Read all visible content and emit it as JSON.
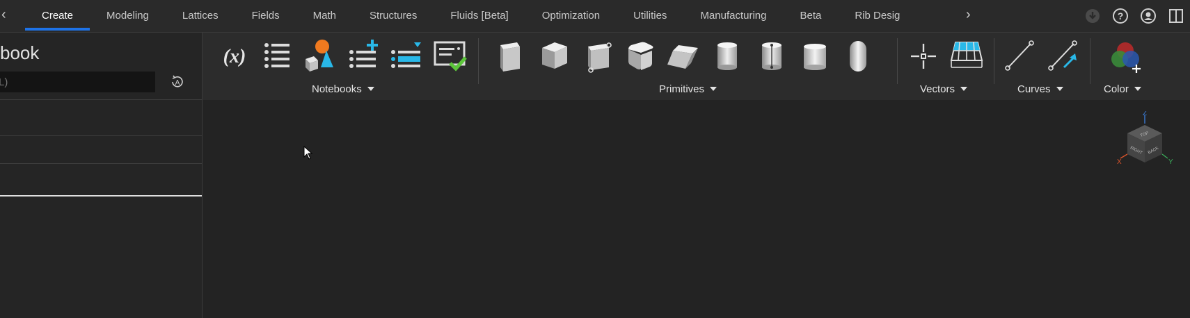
{
  "tabs": [
    {
      "label": "Create",
      "active": true
    },
    {
      "label": "Modeling"
    },
    {
      "label": "Lattices"
    },
    {
      "label": "Fields"
    },
    {
      "label": "Math"
    },
    {
      "label": "Structures"
    },
    {
      "label": "Fluids [Beta]"
    },
    {
      "label": "Optimization"
    },
    {
      "label": "Utilities"
    },
    {
      "label": "Manufacturing"
    },
    {
      "label": "Beta"
    },
    {
      "label": "Rib Desig"
    }
  ],
  "top_icons": [
    "download-icon",
    "help-icon",
    "account-icon",
    "panel-toggle-icon"
  ],
  "left_panel": {
    "title": "book",
    "input_value": "L)",
    "refresh_icon_letter": "A"
  },
  "ribbon": {
    "groups": [
      {
        "label": "Notebooks"
      },
      {
        "label": "Primitives"
      },
      {
        "label": "Vectors"
      },
      {
        "label": "Curves"
      },
      {
        "label": "Color"
      }
    ],
    "variable_button_text": "(x)"
  },
  "viewcube": {
    "faces": [
      "TOP",
      "RIGHT",
      "BACK"
    ],
    "axes": [
      "X",
      "Y",
      "Z"
    ]
  },
  "colors": {
    "accent": "#1e73e8",
    "background": "#232323",
    "ribbon": "#2c2c2c",
    "orange": "#f07a1f",
    "cyan": "#29b8e8",
    "green": "#5cc63a"
  }
}
